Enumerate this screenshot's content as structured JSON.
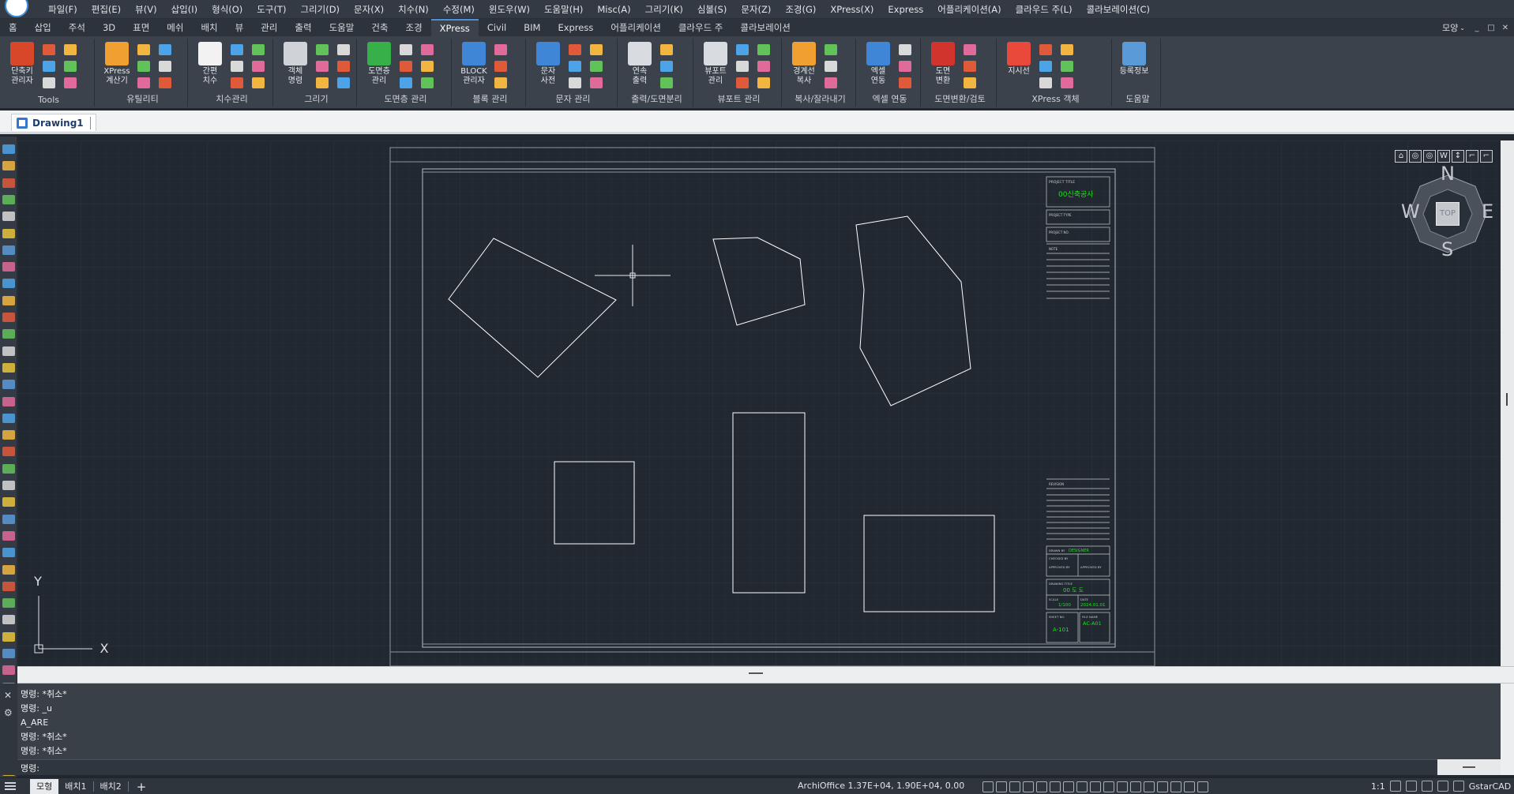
{
  "menubar": {
    "items": [
      "파일(F)",
      "편집(E)",
      "뷰(V)",
      "삽입(I)",
      "형식(O)",
      "도구(T)",
      "그리기(D)",
      "문자(X)",
      "치수(N)",
      "수정(M)",
      "윈도우(W)",
      "도움말(H)",
      "Misc(A)",
      "그리기(K)",
      "심볼(S)",
      "문자(Z)",
      "조경(G)",
      "XPress(X)",
      "Express",
      "어플리케이션(A)",
      "클라우드 주(L)",
      "콜라보레이션(C)"
    ]
  },
  "ribbon_tabs": {
    "items": [
      "홈",
      "삽입",
      "주석",
      "3D",
      "표면",
      "메쉬",
      "배치",
      "뷰",
      "관리",
      "출력",
      "도움말",
      "건축",
      "조경",
      "XPress",
      "Civil",
      "BIM",
      "Express",
      "어플리케이션",
      "클라우드 주",
      "콜라보레이션"
    ],
    "active": "XPress",
    "workspace": "모양",
    "window_controls": [
      "_",
      "□",
      "✕"
    ]
  },
  "ribbon_panels": [
    {
      "title": "Tools",
      "big_label": "단축키\n관리자",
      "color": "#d9472b"
    },
    {
      "title": "유틸리티",
      "big_label": "XPress\n계산기",
      "color": "#f0a030"
    },
    {
      "title": "치수관리",
      "big_label": "간편\n치수",
      "color": "#f2f2f2"
    },
    {
      "title": "그리기",
      "big_label": "객체\n명령",
      "color": "#cfd3d8"
    },
    {
      "title": "도면층 관리",
      "big_label": "도면층\n관리",
      "color": "#38b04a"
    },
    {
      "title": "블록 관리",
      "big_label": "BLOCK\n관리자",
      "color": "#3f86d6"
    },
    {
      "title": "문자 관리",
      "big_label": "문자\n사전",
      "color": "#3f86d6"
    },
    {
      "title": "출력/도면분리",
      "big_label": "연속\n출력",
      "color": "#d8dbe0"
    },
    {
      "title": "뷰포트 관리",
      "big_label": "뷰포트\n관리",
      "color": "#d8dbe0"
    },
    {
      "title": "복사/잘라내기",
      "big_label": "경계선\n복사",
      "color": "#f0a030"
    },
    {
      "title": "엑셀 연동",
      "big_label": "엑셀\n연동",
      "color": "#3f86d6"
    },
    {
      "title": "도면변환/검토",
      "big_label": "도면\n변환",
      "color": "#d0342c"
    },
    {
      "title": "XPress 객체",
      "big_label": "지시선",
      "color": "#e8493a"
    },
    {
      "title": "도움말",
      "big_label": "등록정보",
      "color": "#5a9ad8"
    }
  ],
  "file_tab": {
    "label": "Drawing1"
  },
  "viewcube": {
    "north": "N",
    "south": "S",
    "east": "E",
    "west": "W",
    "top": "TOP",
    "toolbar": [
      "⌂",
      "◎",
      "◎",
      "W",
      "↕",
      "⌐",
      "⌐"
    ]
  },
  "ucs": {
    "x": "X",
    "y": "Y"
  },
  "title_block": {
    "project_title_label": "PROJECT TITLE",
    "project_title": "00신축공사",
    "project_type_label": "PROJECT TYPE",
    "project_no_label": "PROJECT NO.",
    "note_label": "NOTE",
    "revision_label": "REVISION",
    "drawn_by_label": "DRAWN BY",
    "drawn_by": "DESIGNER",
    "checked_by_label": "CHECKED BY",
    "approved_by_label": "APPROVED BY",
    "drawing_title_label": "DRAWING TITLE",
    "drawing_title": "00 도 도",
    "scale_label": "SCALE",
    "scale": "1/100",
    "date_label": "DATE",
    "date": "2024.01.01",
    "sheet_no_label": "SHEET NO.",
    "sheet_no": "A-101",
    "file_name_label": "FILE NAME",
    "file_name": "AC-A01"
  },
  "command": {
    "history": [
      "명령: *취소*",
      "명령: _u",
      "A_ARE",
      "명령: *취소*",
      "명령: *취소*"
    ],
    "prompt_label": "명령:",
    "prompt_value": ""
  },
  "statusbar": {
    "layout_tabs": [
      "모형",
      "배치1",
      "배치2"
    ],
    "active_layout": "모형",
    "add_label": "+",
    "coords": "ArchiOffice  1.37E+04, 1.90E+04, 0.00",
    "scale": "1:1",
    "product": "GstarCAD"
  },
  "colors": {
    "canvas_bg": "#212830",
    "grid_minor": "#262d36",
    "grid_major": "#2c3440",
    "entity": "#ffffff",
    "sheet_border": "#8c939b",
    "title_text_green": "#19e619",
    "accent_blue": "#4c90d8"
  }
}
